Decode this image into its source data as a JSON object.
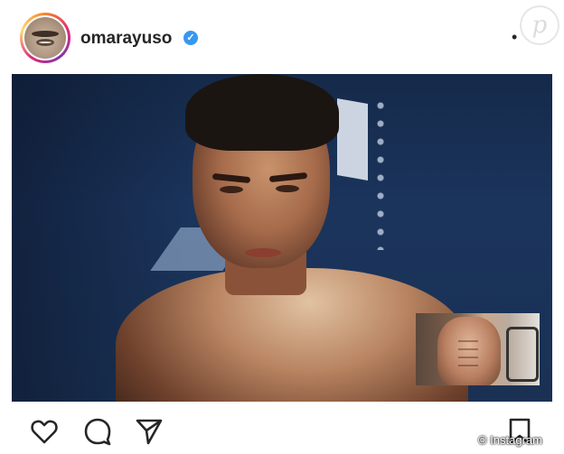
{
  "post": {
    "username": "omarayuso",
    "verified_mark": "✓",
    "more_label": "•",
    "watermark_letter": "p"
  },
  "credit": {
    "text": "© Instagram"
  },
  "icons": {
    "like": "heart-icon",
    "comment": "comment-icon",
    "share": "send-icon",
    "save": "bookmark-icon",
    "verified": "verified-badge-icon"
  },
  "colors": {
    "verified": "#3897f0",
    "text": "#262626",
    "ring_start": "#f58529",
    "ring_end": "#8134af"
  }
}
